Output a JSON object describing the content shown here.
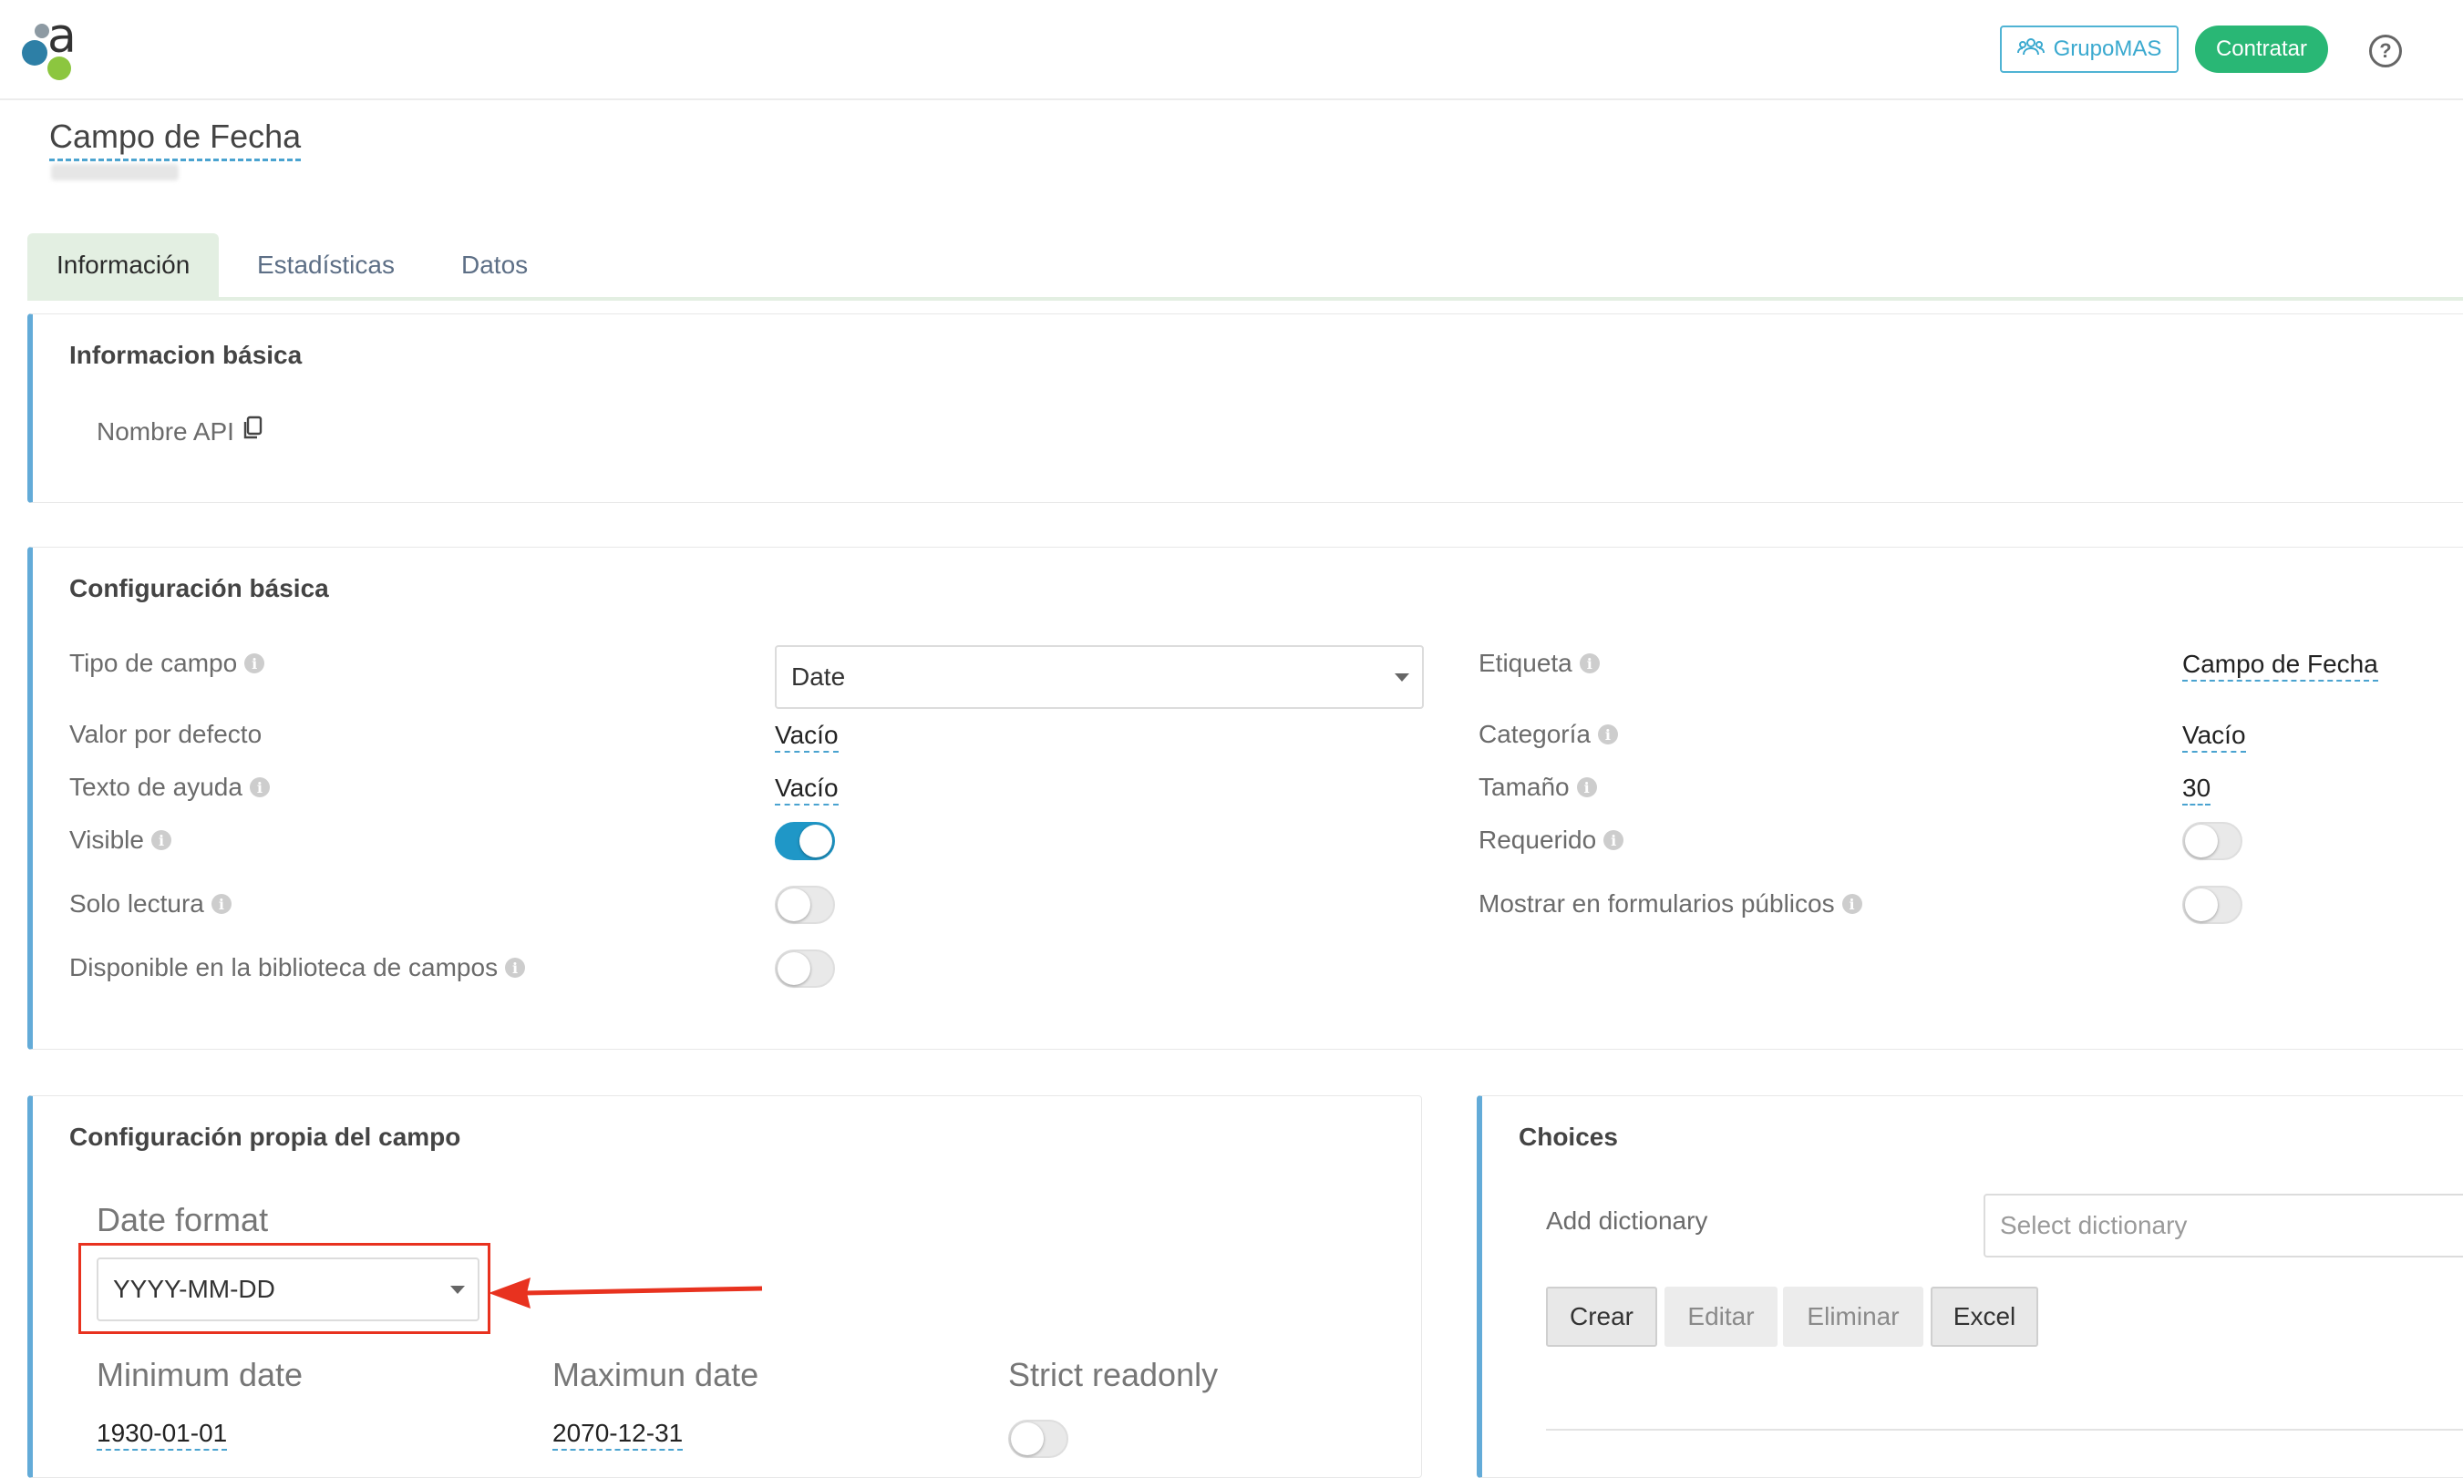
{
  "header": {
    "logo_letter": "a",
    "grupo_label": "GrupoMAS",
    "contratar_label": "Contratar",
    "help_symbol": "?"
  },
  "page": {
    "title": "Campo de Fecha"
  },
  "tabs": [
    {
      "label": "Información",
      "active": true
    },
    {
      "label": "Estadísticas",
      "active": false
    },
    {
      "label": "Datos",
      "active": false
    }
  ],
  "basic_info": {
    "title": "Informacion básica",
    "api_name_label": "Nombre API"
  },
  "basic_config": {
    "title": "Configuración básica",
    "field_type_label": "Tipo de campo",
    "field_type_value": "Date",
    "default_value_label": "Valor por defecto",
    "default_value": "Vacío",
    "help_text_label": "Texto de ayuda",
    "help_text_value": "Vacío",
    "visible_label": "Visible",
    "visible": true,
    "readonly_label": "Solo lectura",
    "readonly": false,
    "library_label": "Disponible en la biblioteca de campos",
    "library": false,
    "label_label": "Etiqueta",
    "label_value": "Campo de Fecha",
    "category_label": "Categoría",
    "category_value": "Vacío",
    "size_label": "Tamaño",
    "size_value": "30",
    "required_label": "Requerido",
    "required": false,
    "public_forms_label": "Mostrar en formularios públicos",
    "public_forms": false
  },
  "field_config": {
    "title": "Configuración propia del campo",
    "date_format_label": "Date format",
    "date_format_value": "YYYY-MM-DD",
    "min_date_label": "Minimum date",
    "min_date_value": "1930-01-01",
    "max_date_label": "Maximun date",
    "max_date_value": "2070-12-31",
    "strict_readonly_label": "Strict readonly",
    "strict_readonly": false
  },
  "choices": {
    "title": "Choices",
    "add_dictionary_label": "Add dictionary",
    "dictionary_placeholder": "Select dictionary",
    "buttons": {
      "create": "Crear",
      "edit": "Editar",
      "delete": "Eliminar",
      "excel": "Excel"
    }
  },
  "colors": {
    "accent_blue": "#63abd8",
    "green": "#29b775",
    "toggle_on": "#1f97c7",
    "annotation_red": "#e8321f"
  }
}
